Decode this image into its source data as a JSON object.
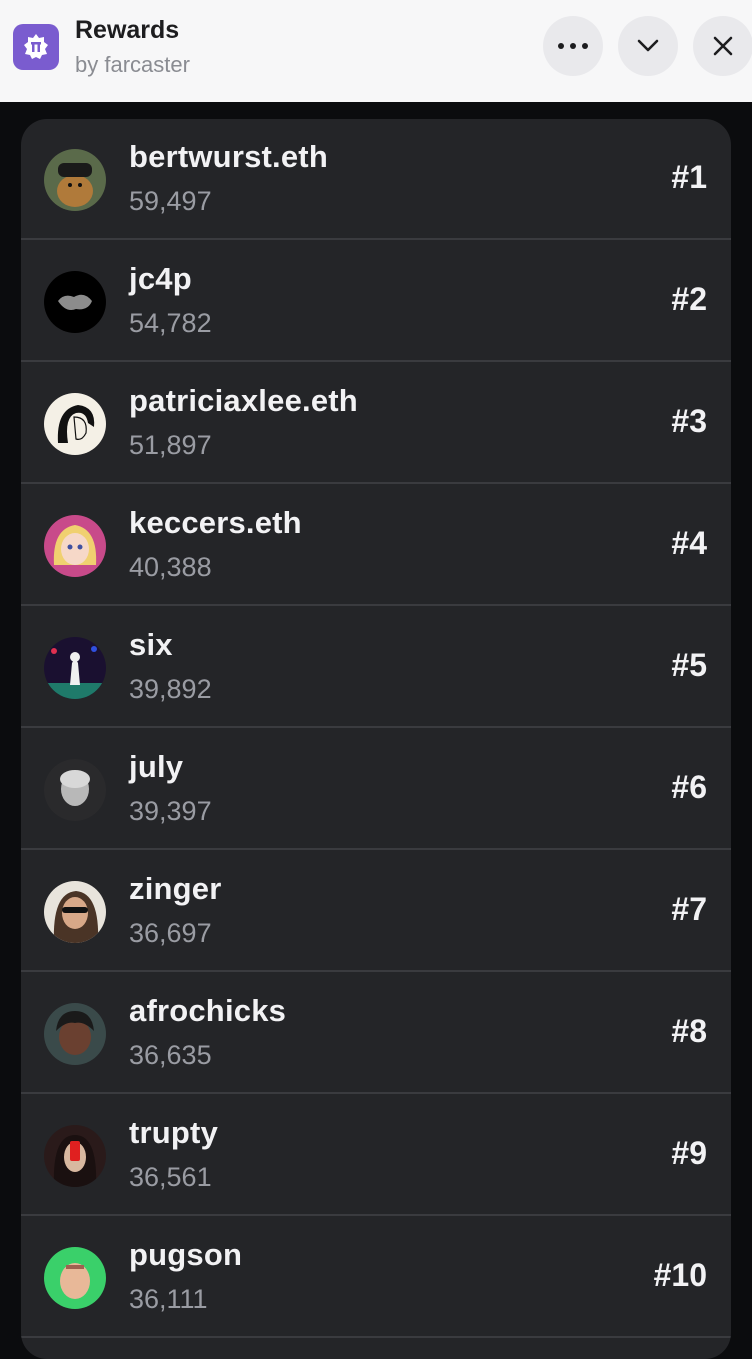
{
  "header": {
    "title": "Rewards",
    "subtitle": "by farcaster",
    "app_icon": "farcaster-logo-icon",
    "controls": [
      {
        "name": "more-options-button",
        "icon": "ellipsis-icon"
      },
      {
        "name": "collapse-button",
        "icon": "chevron-down-icon"
      },
      {
        "name": "close-button",
        "icon": "close-icon"
      }
    ]
  },
  "leaderboard": [
    {
      "username": "bertwurst.eth",
      "score": "59,497",
      "rank": "#1"
    },
    {
      "username": "jc4p",
      "score": "54,782",
      "rank": "#2"
    },
    {
      "username": "patriciaxlee.eth",
      "score": "51,897",
      "rank": "#3"
    },
    {
      "username": "keccers.eth",
      "score": "40,388",
      "rank": "#4"
    },
    {
      "username": "six",
      "score": "39,892",
      "rank": "#5"
    },
    {
      "username": "july",
      "score": "39,397",
      "rank": "#6"
    },
    {
      "username": "zinger",
      "score": "36,697",
      "rank": "#7"
    },
    {
      "username": "afrochicks",
      "score": "36,635",
      "rank": "#8"
    },
    {
      "username": "trupty",
      "score": "36,561",
      "rank": "#9"
    },
    {
      "username": "pugson",
      "score": "36,111",
      "rank": "#10"
    }
  ],
  "colors": {
    "header_bg": "#f7f7f8",
    "brand": "#7a5ccf",
    "panel_bg": "#242528",
    "page_bg": "#0b0c0e",
    "primary_text": "#f2f2f4",
    "secondary_text": "#9a9ca3"
  }
}
